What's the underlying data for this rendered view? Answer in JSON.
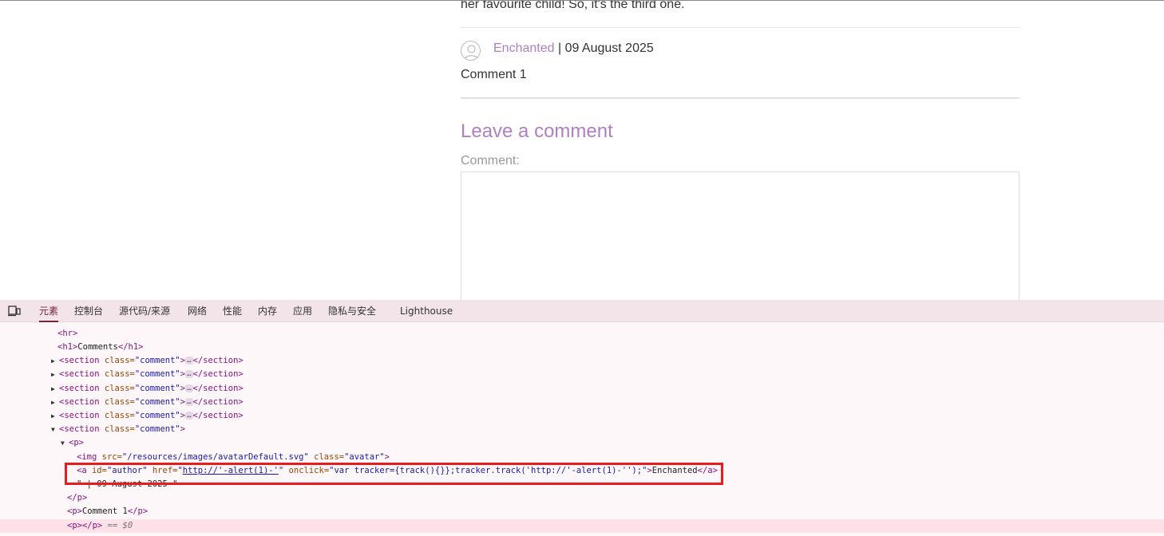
{
  "page": {
    "prev_text": "her favourite child! So, it's the third one.",
    "comment": {
      "author": "Enchanted",
      "separator": " | ",
      "date": "09 August 2025",
      "body": "Comment 1"
    },
    "leave_heading": "Leave a comment",
    "comment_label": "Comment:"
  },
  "devtools": {
    "tabs": [
      "元素",
      "控制台",
      "源代码/来源",
      "网络",
      "性能",
      "内存",
      "应用",
      "隐私与安全",
      "Lighthouse"
    ],
    "active_tab": "元素",
    "dom": {
      "hr": "<hr>",
      "h1_open": "<h1>",
      "h1_text": "Comments",
      "h1_close": "</h1>",
      "section_open": "<section",
      "class_attr": "class=",
      "comment_val": "\"comment\"",
      "gt": ">",
      "ellipsis": "…",
      "section_close": "</section>",
      "p_open": "<p>",
      "p_close": "</p>",
      "img_open": "<img",
      "src_attr": "src=",
      "src_val": "\"/resources/images/avatarDefault.svg\"",
      "avatar_val": "\"avatar\"",
      "a_open": "<a",
      "id_attr": "id=",
      "id_val": "\"author\"",
      "href_attr": "href=",
      "href_val": "http://'-alert(1)-'",
      "onclick_attr": "onclick=",
      "onclick_val": "\"var tracker={track(){}};tracker.track('http://'-alert(1)-'');\"",
      "a_text": "Enchanted",
      "a_close": "</a>",
      "date_text": "\" | 09 August 2025 \"",
      "comment_text": "Comment 1",
      "empty_p": "<p></p>",
      "dollar": "== $0"
    }
  }
}
